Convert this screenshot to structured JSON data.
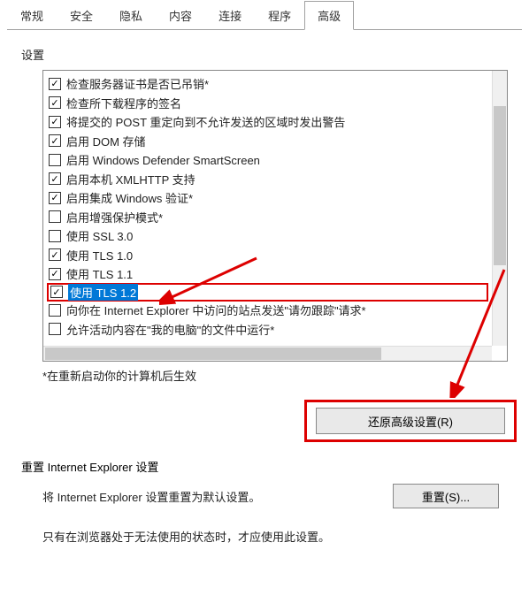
{
  "tabs": {
    "items": [
      {
        "label": "常规"
      },
      {
        "label": "安全"
      },
      {
        "label": "隐私"
      },
      {
        "label": "内容"
      },
      {
        "label": "连接"
      },
      {
        "label": "程序"
      },
      {
        "label": "高级"
      }
    ],
    "activeIndex": 6
  },
  "sectionLabel": "设置",
  "items": [
    {
      "checked": true,
      "label": "检查服务器证书是否已吊销*"
    },
    {
      "checked": true,
      "label": "检查所下载程序的签名"
    },
    {
      "checked": true,
      "label": "将提交的 POST 重定向到不允许发送的区域时发出警告"
    },
    {
      "checked": true,
      "label": "启用 DOM 存储"
    },
    {
      "checked": false,
      "label": "启用 Windows Defender SmartScreen"
    },
    {
      "checked": true,
      "label": "启用本机 XMLHTTP 支持"
    },
    {
      "checked": true,
      "label": "启用集成 Windows 验证*"
    },
    {
      "checked": false,
      "label": "启用增强保护模式*"
    },
    {
      "checked": false,
      "label": "使用 SSL 3.0"
    },
    {
      "checked": true,
      "label": "使用 TLS 1.0"
    },
    {
      "checked": true,
      "label": "使用 TLS 1.1"
    },
    {
      "checked": true,
      "label": "使用 TLS 1.2",
      "highlight": true
    },
    {
      "checked": false,
      "label": "向你在 Internet Explorer 中访问的站点发送\"请勿跟踪\"请求*"
    },
    {
      "checked": false,
      "label": "允许活动内容在\"我的电脑\"的文件中运行*"
    }
  ],
  "note": "*在重新启动你的计算机后生效",
  "restoreButton": "还原高级设置(R)",
  "resetSection": {
    "title": "重置 Internet Explorer 设置",
    "desc": "将 Internet Explorer 设置重置为默认设置。",
    "button": "重置(S)...",
    "hint": "只有在浏览器处于无法使用的状态时，才应使用此设置。"
  }
}
